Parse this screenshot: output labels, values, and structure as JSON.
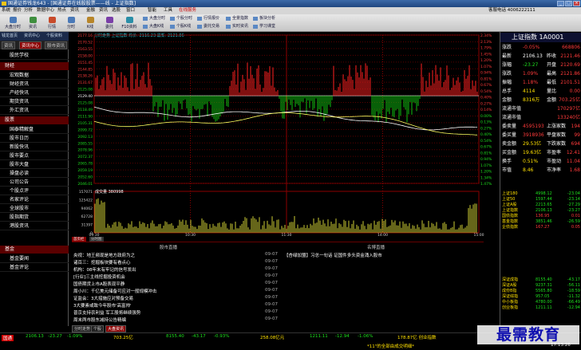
{
  "window": {
    "title": "国通证券钱龙643 - [国通证券在线股股票——线 - 上证指数]",
    "min": "_",
    "max": "□",
    "close": "×"
  },
  "menu": {
    "items": [
      "系统",
      "报价",
      "分析",
      "数据中心",
      "热点",
      "资讯",
      "金融",
      "资讯",
      "选股",
      "窗口",
      "智能",
      "工具",
      "在线服务"
    ],
    "account": "客服电话  4006222111"
  },
  "toolbar": {
    "big": [
      "大盘分时",
      "资讯",
      "行情",
      "分时",
      "K线",
      "委托",
      "F10资料"
    ],
    "small": [
      "大盘分时",
      "大盘K线",
      "个股分时",
      "个股K线",
      "行情报价",
      "委托交易",
      "全景指数",
      "实时资讯",
      "板块分析",
      "学习课堂"
    ]
  },
  "left": {
    "topbar": [
      "钱龙首页",
      "资讯中心",
      "个股资料"
    ],
    "tabs": [
      "资讯",
      "资讯中心",
      "股市资讯"
    ],
    "sections": [
      {
        "title": "",
        "items": [
          "股民学校"
        ]
      },
      {
        "title": "财经",
        "items": [
          "宏观数据",
          "财经资讯",
          "产经快讯",
          "期货资讯",
          "外汇资讯"
        ]
      },
      {
        "title": "股票",
        "items": [
          "国泰精解盘",
          "股市日历",
          "新股快讯",
          "股市要点",
          "股市大盘",
          "操盘必读",
          "公司公告",
          "个股点评",
          "名家评论",
          "全球股市",
          "股指期货",
          "港股资讯"
        ]
      },
      {
        "title": "基金",
        "items": [
          "基金要闻",
          "基金评论"
        ]
      }
    ]
  },
  "chart": {
    "header": "分时走势  上证指数  均价: 2116.23  最新: 2121.86",
    "left_ticks": [
      "2177.16",
      "2170.52",
      "2163.55",
      "2158.00",
      "2151.45",
      "2144.85",
      "2138.26",
      "2131.67",
      "2125.08",
      "2129.40",
      "2125.08",
      "2118.49",
      "2111.90",
      "2105.31",
      "2099.72",
      "2092.13",
      "2085.55",
      "2078.96",
      "2072.37",
      "2065.78",
      "2059.19",
      "2052.60",
      "2046.01"
    ],
    "right_ticks": [
      "2.34%",
      "2.13%",
      "1.79%",
      "1.45%",
      "1.20%",
      "1.07%",
      "0.94%",
      "0.81%",
      "0.67%",
      "0.54%",
      "0.40%",
      "0.27%",
      "0.14%",
      "0.00%",
      "0.13%",
      "0.27%",
      "0.40%",
      "0.54%",
      "0.67%",
      "0.81%",
      "0.94%",
      "1.07%",
      "1.20%",
      "1.34%",
      "1.47%"
    ],
    "volume_ticks": [
      "157071",
      "125422",
      "94062",
      "62728",
      "31397",
      "0"
    ],
    "volume_label": "成交量  380998",
    "time_labels": [
      "09:30",
      "10:30",
      "11:30",
      "14:00",
      "15:00"
    ],
    "tabs": [
      "首页栏",
      "分时图"
    ]
  },
  "news": {
    "left_title": "股市直播",
    "right_title": "名博直播",
    "items": [
      {
        "text": "央视：地王频现是地方政府为之",
        "date": "09-07"
      },
      {
        "text": "诸百三：挖掘板块要有看点心",
        "date": "09-07"
      },
      {
        "text": "机构：08年末有牢记的信号发出",
        "date": "09-07"
      },
      {
        "text": "[行业]三主线挖掘投资机会",
        "date": "09-07"
      },
      {
        "text": "国债期货上市A股表现平静",
        "date": "09-07"
      },
      {
        "text": "周小川：千亿美元储备可应对一般规模冲击",
        "date": "09-07"
      },
      {
        "text": "证监会：3大措施应对预备交易",
        "date": "09-07"
      },
      {
        "text": "3大要素或致今年股市'高富帅'",
        "date": "09-07"
      },
      {
        "text": "普京支持农利益 军工股将继续强势",
        "date": "09-07"
      },
      {
        "text": "周末两市股东减持公告精编",
        "date": "09-07"
      }
    ],
    "right_items": [
      "【杏绿加盟】习总一句话 证国件多头资金涌入股市"
    ]
  },
  "right": {
    "title": "上证指数 1A0001",
    "rows": [
      {
        "a": "涨跌",
        "b": "-0.05%",
        "c": "",
        "d": "668806"
      },
      {
        "a": "最新",
        "b": "2106.13",
        "c": "昨收",
        "d": "2121.46"
      },
      {
        "a": "涨幅",
        "b": "-23.27",
        "c": "开盘",
        "d": "2120.69"
      },
      {
        "a": "涨跌",
        "b": "1.09%",
        "c": "最高",
        "d": "2121.86"
      },
      {
        "a": "振幅",
        "b": "1.18%",
        "c": "最低",
        "d": "2101.51"
      },
      {
        "a": "总手",
        "b": "4114",
        "c": "量比",
        "d": "0.00"
      },
      {
        "a": "金额",
        "b": "8316万",
        "c": "金额",
        "d": "703.25亿"
      },
      {
        "a": "流通市值",
        "b": "",
        "c": "",
        "d": "170297亿"
      },
      {
        "a": "流通市值",
        "b": "",
        "c": "",
        "d": "133240亿"
      },
      {
        "a": "委卖量",
        "b": "4595193",
        "c": "上涨家数",
        "d": "194"
      },
      {
        "a": "委买量",
        "b": "3918936",
        "c": "平盘家数",
        "d": "99"
      },
      {
        "a": "卖金额",
        "b": "29.53亿",
        "c": "下跌家数",
        "d": "694"
      },
      {
        "a": "买金额",
        "b": "19.63亿",
        "c": "市盈率",
        "d": "12.41"
      },
      {
        "a": "换手",
        "b": "0.51%",
        "c": "市盈动",
        "d": "11.04"
      },
      {
        "a": "市值",
        "b": "8.46",
        "c": "市净率",
        "d": "1.68"
      }
    ],
    "indices": [
      {
        "name": "上证180",
        "v": "4998.12",
        "c": "-23.04"
      },
      {
        "name": "上证50",
        "v": "1597.44",
        "c": "-23.14"
      },
      {
        "name": "上证A股",
        "v": "2213.65",
        "c": "-27.29"
      },
      {
        "name": "上证指数",
        "v": "2106.13",
        "c": "-23.27"
      },
      {
        "name": "国债指数",
        "v": "136.95",
        "c": "0.01"
      },
      {
        "name": "基金指数",
        "v": "3851.46",
        "c": "-26.59"
      },
      {
        "name": "企债指数",
        "v": "167.27",
        "c": "0.05"
      }
    ],
    "indices2": [
      {
        "name": "深证成指",
        "v": "8155.40",
        "c": "-43.17"
      },
      {
        "name": "深证A股",
        "v": "9237.31",
        "c": "-56.11"
      },
      {
        "name": "成份B指",
        "v": "5565.80",
        "c": "-18.59"
      },
      {
        "name": "深证综指",
        "v": "957.05",
        "c": "-11.32"
      },
      {
        "name": "中小板指",
        "v": "4780.00",
        "c": "-66.49"
      },
      {
        "name": "创业板指",
        "v": "1211.11",
        "c": "-12.94"
      }
    ]
  },
  "status_tabs": [
    "分时走势",
    "个股",
    "大盘资讯"
  ],
  "bottom": {
    "sh_label": "2106.13",
    "sh_change": "-23.27",
    "sh_pct": "-1.09%",
    "sh_amt": "703.25亿",
    "sz_label": "8155.40",
    "sz_change": "-43.17",
    "sz_pct": "-0.93%",
    "sz_amt": "258.08亿元",
    "cy_label": "1211.11",
    "cy_change": "-12.94",
    "cy_pct": "-1.06%",
    "cy_amt": "178.87亿",
    "ticker": "178.87亿 创业指数",
    "marquee": "*11\"的全部由成交明细*",
    "clock": "17:13:26"
  },
  "brand": "最需教育",
  "colors": {
    "up": "#ff3a3a",
    "down": "#1ee01e",
    "bg": "#000000",
    "grid": "#6b0000",
    "title": "#1f4680"
  }
}
